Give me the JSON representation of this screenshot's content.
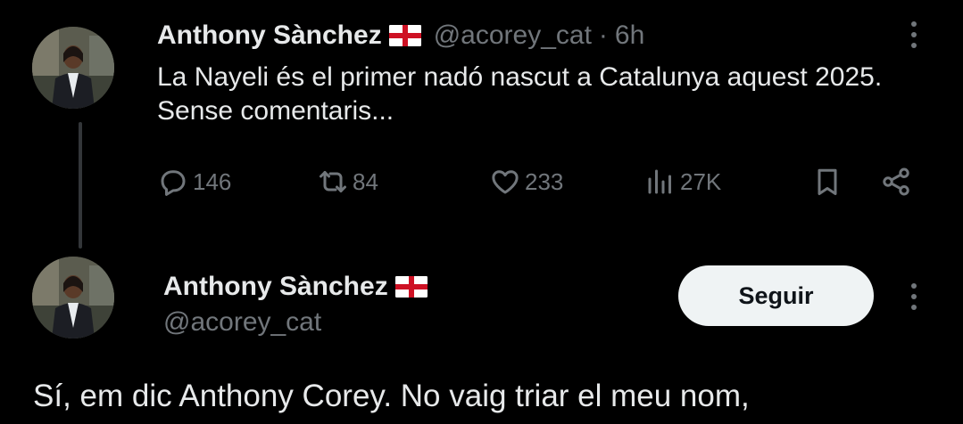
{
  "tweet": {
    "author_name": "Anthony Sànchez",
    "handle": "@acorey_cat",
    "separator": "·",
    "time": "6h",
    "text": "La Nayeli és el primer nadó nascut a Catalunya aquest 2025. Sense comentaris...",
    "actions": {
      "replies": "146",
      "reposts": "84",
      "likes": "233",
      "views": "27K"
    }
  },
  "reply": {
    "author_name": "Anthony Sànchez",
    "handle": "@acorey_cat",
    "follow_label": "Seguir",
    "text": "Sí, em dic Anthony Corey. No vaig triar el meu nom,"
  },
  "icons": {
    "flag": "england-flag-icon",
    "reply": "reply-icon",
    "repost": "repost-icon",
    "like": "heart-icon",
    "views": "views-icon",
    "bookmark": "bookmark-icon",
    "share": "share-icon",
    "more": "more-icon"
  },
  "colors": {
    "background": "#000000",
    "text": "#e7e9ea",
    "secondary": "#71767b",
    "button_bg": "#eff3f4"
  }
}
